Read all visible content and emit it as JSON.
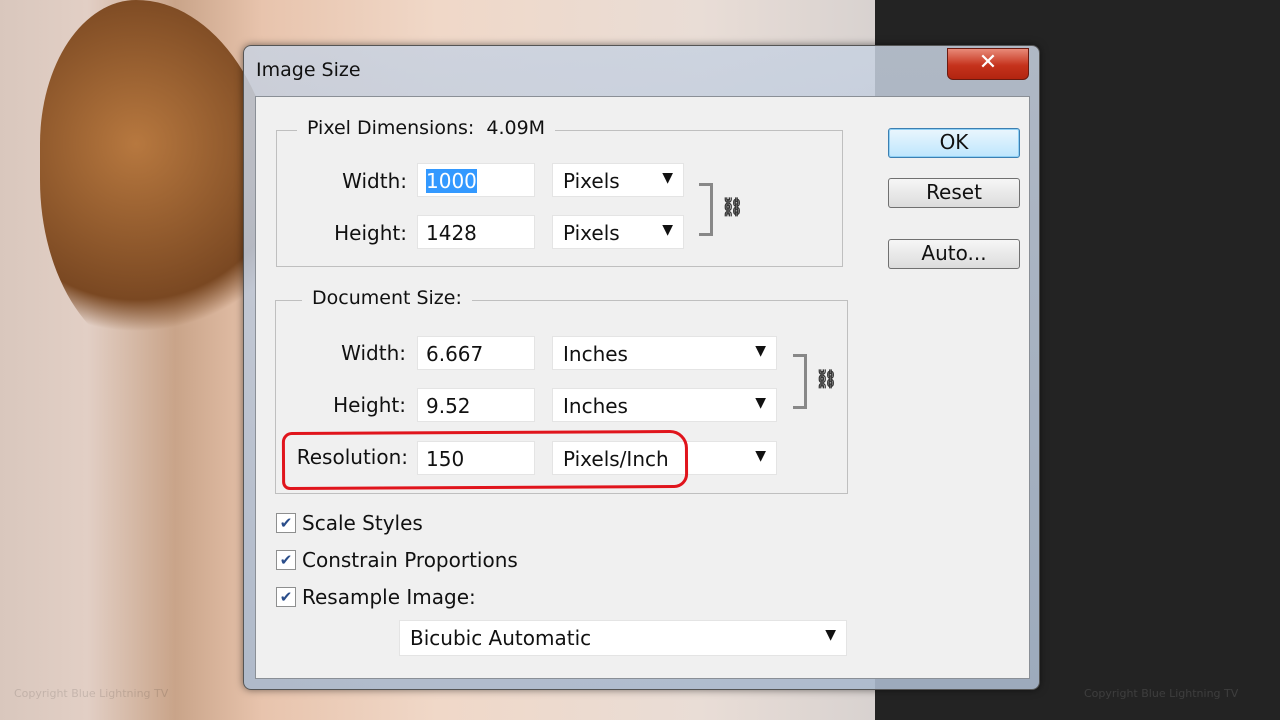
{
  "dialog": {
    "title": "Image Size",
    "close_label": "✕"
  },
  "pixel_dimensions": {
    "legend": "Pixel Dimensions:",
    "size": "4.09M",
    "width_label": "Width:",
    "width_value": "1000",
    "width_unit": "Pixels",
    "height_label": "Height:",
    "height_value": "1428",
    "height_unit": "Pixels"
  },
  "document_size": {
    "legend": "Document Size:",
    "width_label": "Width:",
    "width_value": "6.667",
    "width_unit": "Inches",
    "height_label": "Height:",
    "height_value": "9.52",
    "height_unit": "Inches",
    "resolution_label": "Resolution:",
    "resolution_value": "150",
    "resolution_unit": "Pixels/Inch"
  },
  "buttons": {
    "ok": "OK",
    "reset": "Reset",
    "auto": "Auto..."
  },
  "options": {
    "scale_styles": "Scale Styles",
    "constrain": "Constrain Proportions",
    "resample": "Resample Image:",
    "resample_method": "Bicubic Automatic"
  },
  "watermark": {
    "left": "Copyright  Blue Lightning TV",
    "right": "Copyright  Blue Lightning TV"
  },
  "colors": {
    "annotation": "#e0141c",
    "selection": "#3399ff"
  }
}
